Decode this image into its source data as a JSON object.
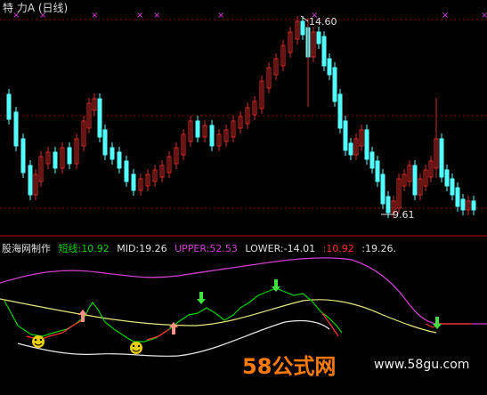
{
  "window": {
    "title": "特  力A (日线)"
  },
  "price_chart": {
    "peak_label": "14.60",
    "low_label": "9.61",
    "up_color": "#d42828",
    "down_color": "#54ffff",
    "dashed_grid_color": "#8b0000"
  },
  "indicator_legend": {
    "name": "股海网制作",
    "short_label": "短线:10.92",
    "mid_label": "MID:19.26",
    "upper_label": "UPPER:52.53",
    "lower_label": "LOWER:-14.01",
    "value_red": ":10.92",
    "value_white": ":19.26."
  },
  "colors": {
    "short": "#00d200",
    "mid": "#e8e8e8",
    "upper": "#d040d0",
    "lower": "#d8d8d8",
    "red": "#ff3030",
    "yellow": "#e8e880"
  },
  "watermark": {
    "brand": "58公式网",
    "url": "www.58gu.com"
  }
}
